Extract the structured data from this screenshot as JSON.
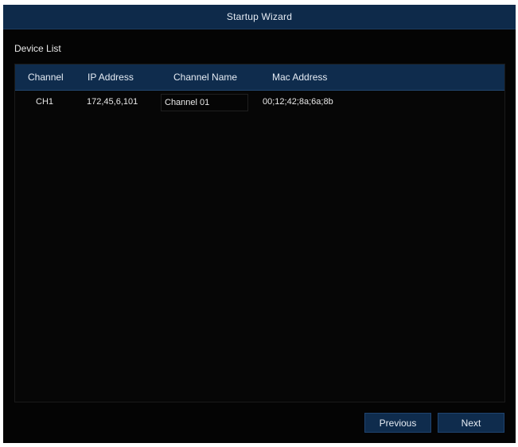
{
  "window": {
    "title": "Startup Wizard"
  },
  "section": {
    "label": "Device List"
  },
  "table": {
    "headers": {
      "channel": "Channel",
      "ip": "IP Address",
      "name": "Channel Name",
      "mac": "Mac Address"
    },
    "rows": [
      {
        "channel": "CH1",
        "ip": "172,45,6,101",
        "name": "Channel 01",
        "mac": "00;12;42;8a;6a;8b"
      }
    ]
  },
  "buttons": {
    "previous": "Previous",
    "next": "Next"
  },
  "colors": {
    "background": "#040404",
    "accent": "#0f2c4d",
    "text": "#e6ecf4"
  }
}
